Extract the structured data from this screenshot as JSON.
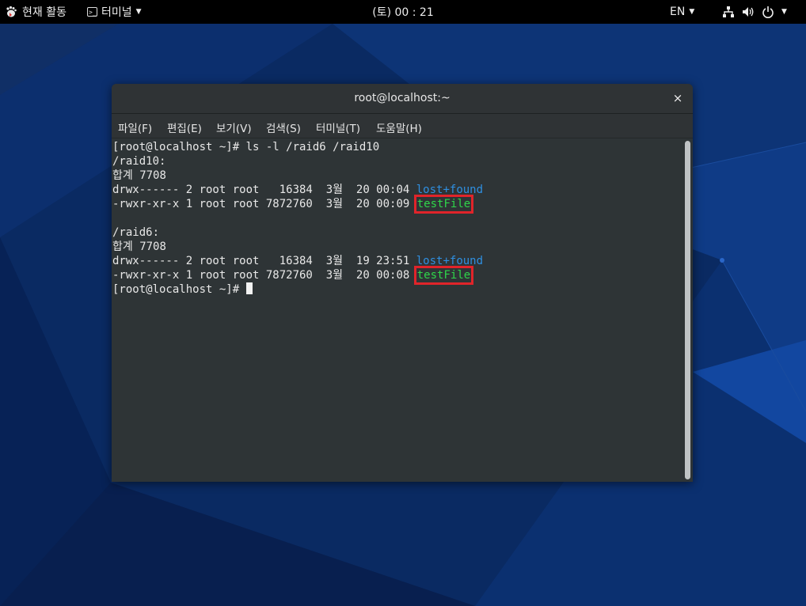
{
  "topbar": {
    "activities_label": "현재 활동",
    "app_menu_label": "터미널",
    "clock": "(토) 00 : 21",
    "language": "EN"
  },
  "window": {
    "title": "root@localhost:~",
    "close_label": "×",
    "menu": [
      "파일(F)",
      "편집(E)",
      "보기(V)",
      "검색(S)",
      "터미널(T)",
      "도움말(H)"
    ]
  },
  "terminal": {
    "lines": [
      {
        "text": "[root@localhost ~]# ls -l /raid6 /raid10"
      },
      {
        "text": "/raid10:"
      },
      {
        "text": "합계 7708"
      },
      {
        "text": "drwx------ 2 root root   16384  3월  20 00:04 ",
        "name": "lost+found",
        "kind": "dir"
      },
      {
        "text": "-rwxr-xr-x 1 root root 7872760  3월  20 00:09 ",
        "name": "testFile",
        "kind": "file"
      },
      {
        "text": ""
      },
      {
        "text": "/raid6:"
      },
      {
        "text": "합계 7708"
      },
      {
        "text": "drwx------ 2 root root   16384  3월  19 23:51 ",
        "name": "lost+found",
        "kind": "dir"
      },
      {
        "text": "-rwxr-xr-x 1 root root 7872760  3월  20 00:08 ",
        "name": "testFile",
        "kind": "file"
      },
      {
        "text": "[root@localhost ~]# ",
        "cursor": true
      }
    ]
  },
  "colors": {
    "directory": "#2f8fe0",
    "executable": "#2fd54a",
    "highlight_box": "#e0242a",
    "terminal_bg": "#2e3436"
  }
}
